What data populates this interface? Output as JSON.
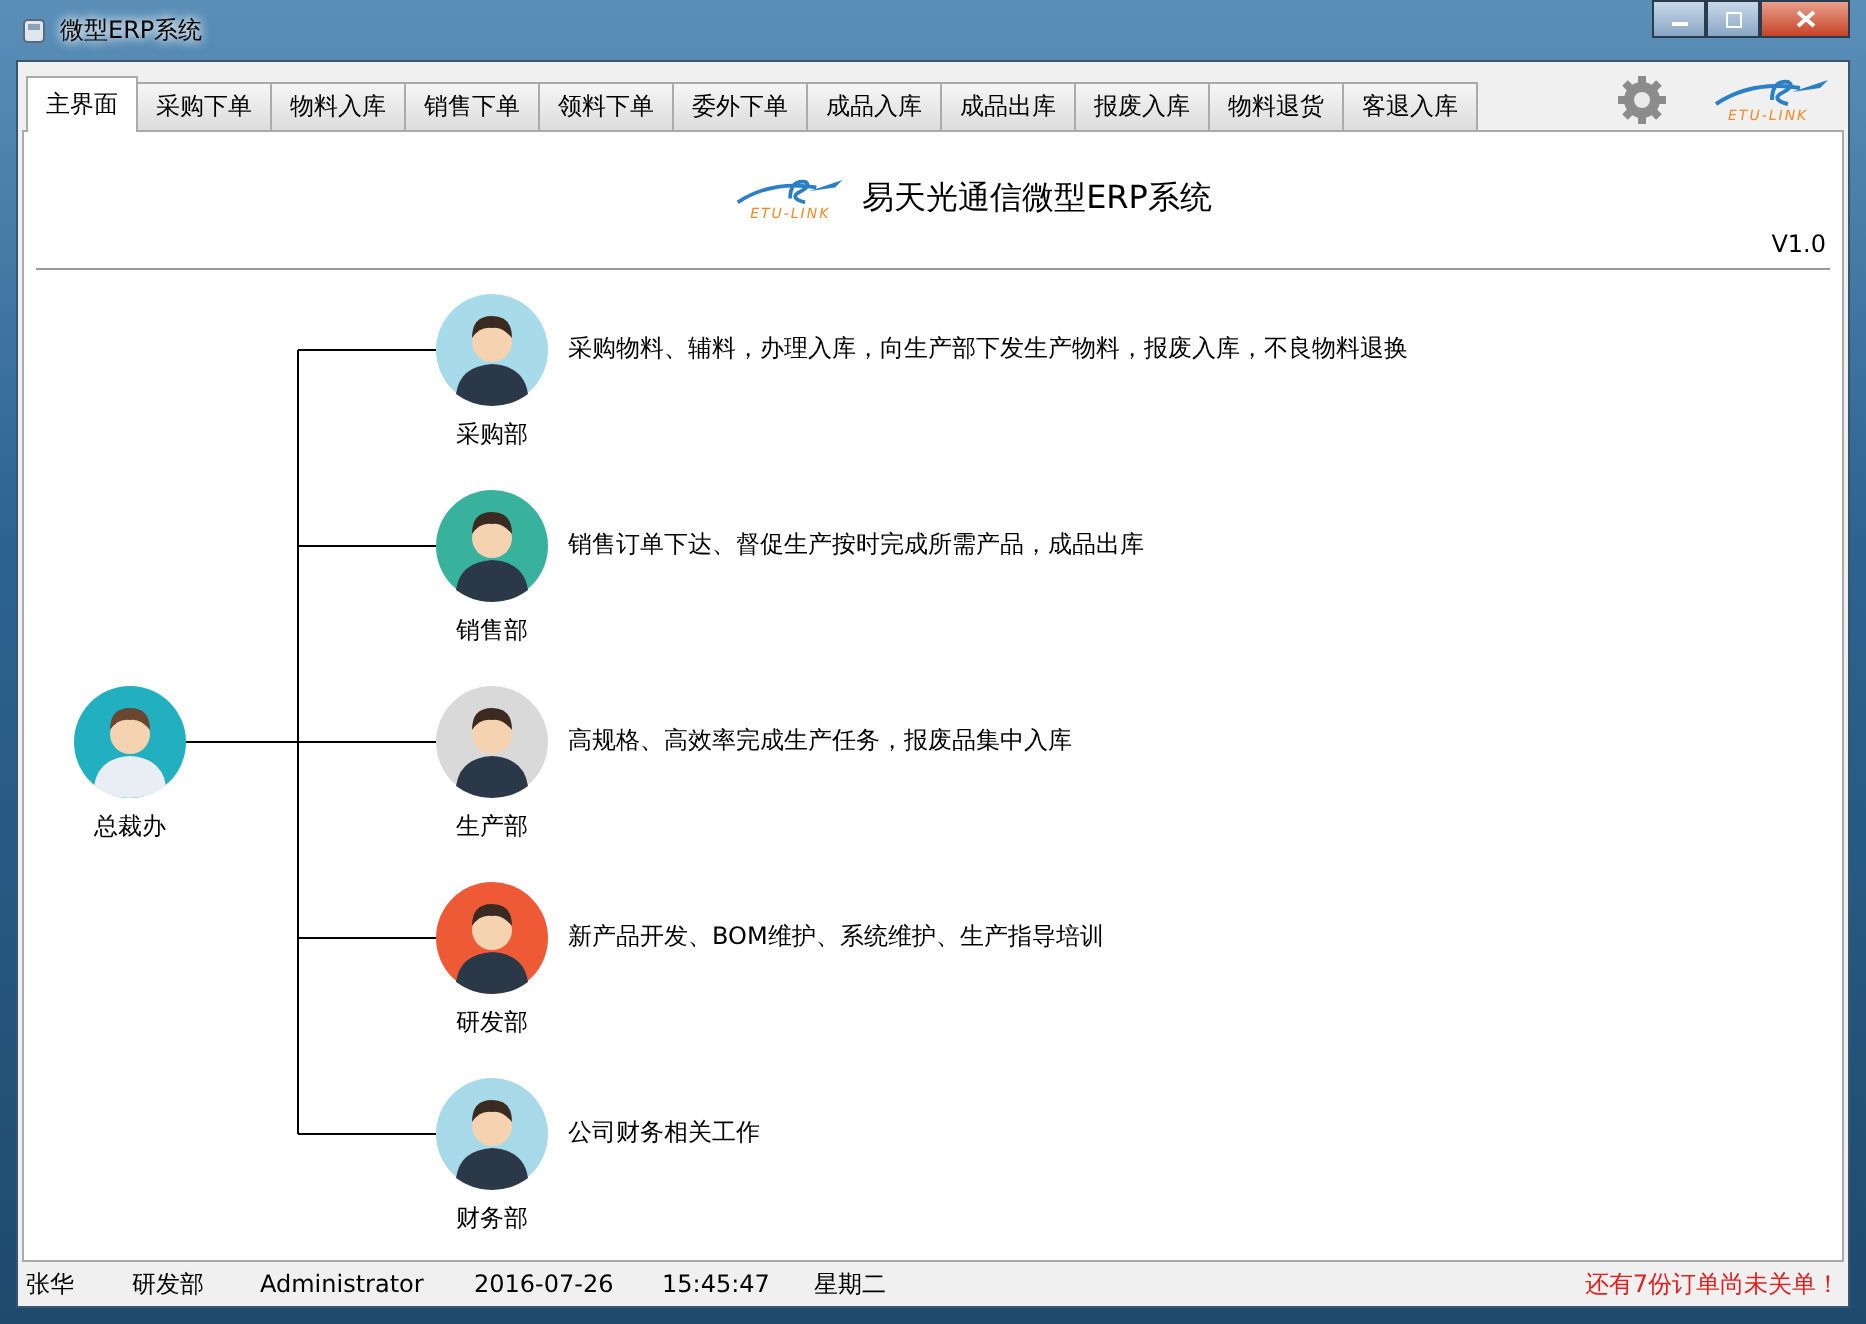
{
  "window": {
    "title": "微型ERP系统"
  },
  "tabs": [
    {
      "label": "主界面",
      "selected": true
    },
    {
      "label": "采购下单",
      "selected": false
    },
    {
      "label": "物料入库",
      "selected": false
    },
    {
      "label": "销售下单",
      "selected": false
    },
    {
      "label": "领料下单",
      "selected": false
    },
    {
      "label": "委外下单",
      "selected": false
    },
    {
      "label": "成品入库",
      "selected": false
    },
    {
      "label": "成品出库",
      "selected": false
    },
    {
      "label": "报废入库",
      "selected": false
    },
    {
      "label": "物料退货",
      "selected": false
    },
    {
      "label": "客退入库",
      "selected": false
    }
  ],
  "corner_logo": {
    "text": "ETU-LINK"
  },
  "header": {
    "logo_text": "ETU-LINK",
    "title": "易天光通信微型ERP系统",
    "version": "V1.0"
  },
  "org_chart": {
    "root": {
      "name": "总裁办",
      "color": "#22b0c0"
    },
    "departments": [
      {
        "name": "采购部",
        "description": "采购物料、辅料，办理入库，向生产部下发生产物料，报废入库，不良物料退换",
        "color": "#a8dbe9"
      },
      {
        "name": "销售部",
        "description": "销售订单下达、督促生产按时完成所需产品，成品出库",
        "color": "#38b29c"
      },
      {
        "name": "生产部",
        "description": "高规格、高效率完成生产任务，报废品集中入库",
        "color": "#d9d9d9"
      },
      {
        "name": "研发部",
        "description": "新产品开发、BOM维护、系统维护、生产指导培训",
        "color": "#ef5a36"
      },
      {
        "name": "财务部",
        "description": "公司财务相关工作",
        "color": "#a8d9e8"
      }
    ]
  },
  "status_bar": {
    "user": "张华",
    "department": "研发部",
    "role": "Administrator",
    "date": "2016-07-26",
    "time": "15:45:47",
    "weekday": "星期二",
    "alert": "还有7份订单尚未关单！"
  }
}
